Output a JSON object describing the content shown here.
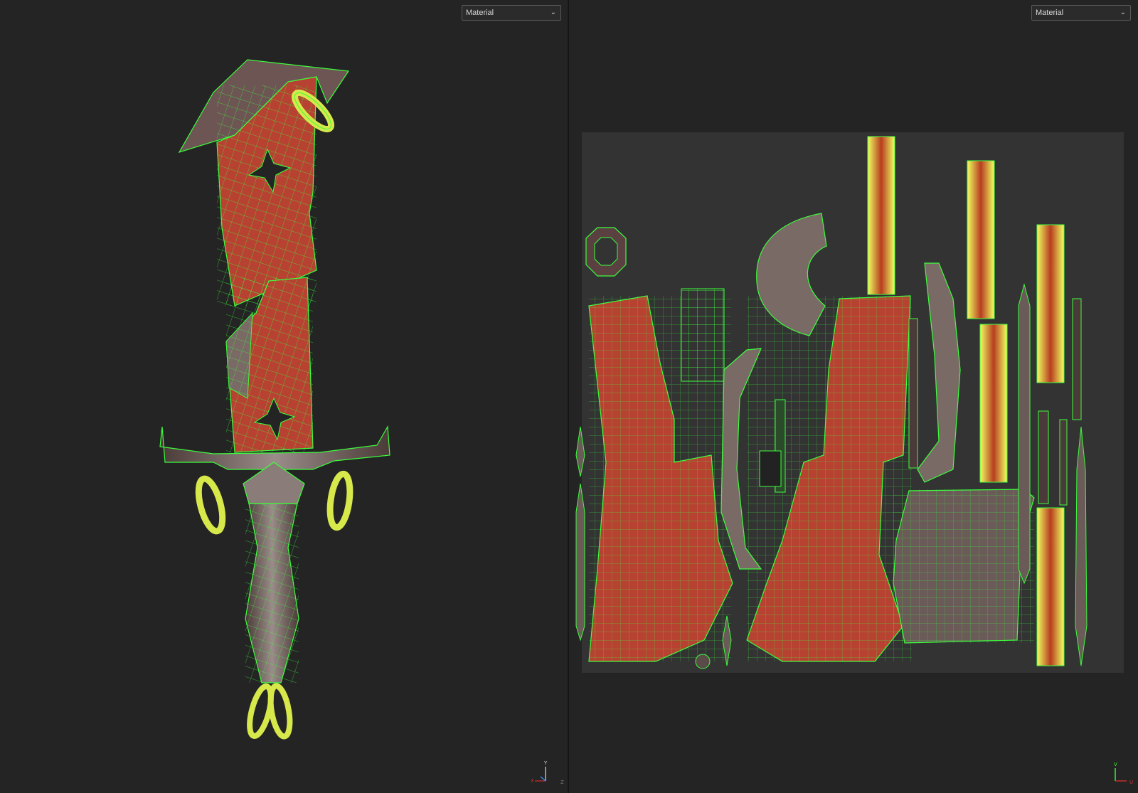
{
  "viewport_3d": {
    "shading_mode": "Material",
    "axis": {
      "vertical": "Y",
      "horizontal": "X",
      "depth": "Z"
    }
  },
  "viewport_uv": {
    "shading_mode": "Material",
    "axis": {
      "vertical": "V",
      "horizontal": "U"
    }
  },
  "colors": {
    "background": "#242424",
    "uv_tile": "#333333",
    "wireframe": "#40ff40",
    "blade_red": "#b84232",
    "metal": "#7a6a66",
    "ring_yellow": "#d6e84a"
  },
  "icons": [
    "chevron-down-icon",
    "axis-gizmo-icon"
  ]
}
